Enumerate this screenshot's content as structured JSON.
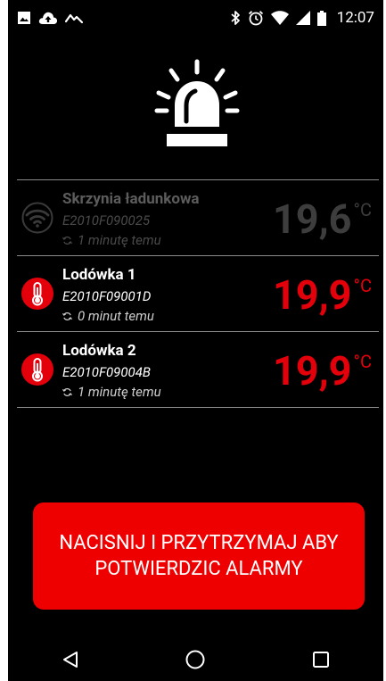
{
  "status_bar": {
    "time": "12:07",
    "left_icons": [
      "image-icon",
      "cloud-upload-icon",
      "activity-icon"
    ],
    "right_icons": [
      "bluetooth-icon",
      "alarm-clock-icon",
      "wifi-icon",
      "signal-icon",
      "battery-icon"
    ]
  },
  "sensors": [
    {
      "name": "Skrzynia ładunkowa",
      "id": "E2010F090025",
      "updated": "1 minutę temu",
      "temperature": "19,6",
      "unit": "°C",
      "icon": "wifi-icon",
      "state": "inactive"
    },
    {
      "name": "Lodówka 1",
      "id": "E2010F09001D",
      "updated": "0 minut temu",
      "temperature": "19,9",
      "unit": "°C",
      "icon": "thermometer-icon",
      "state": "alarm"
    },
    {
      "name": "Lodówka 2",
      "id": "E2010F09004B",
      "updated": "1 minutę temu",
      "temperature": "19,9",
      "unit": "°C",
      "icon": "thermometer-icon",
      "state": "alarm"
    }
  ],
  "ack_button": {
    "label": "NACISNIJ I PRZYTRZYMAJ ABY\nPOTWIERDZIC ALARMY"
  },
  "nav_bar": {
    "items": [
      "back-icon",
      "home-icon",
      "recents-icon"
    ]
  },
  "colors": {
    "alarm_red": "#e3000b",
    "button_red": "#ee0000",
    "inactive_gray": "#3d3d3d",
    "background": "#000000"
  }
}
